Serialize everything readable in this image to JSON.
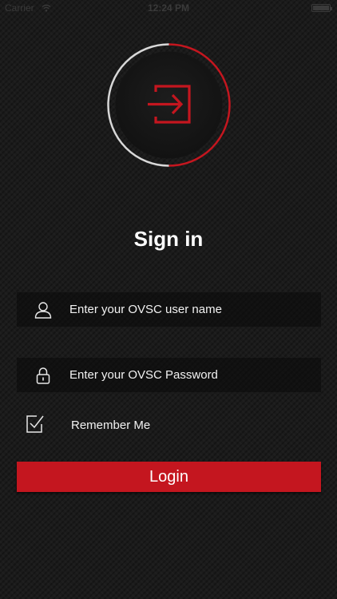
{
  "status_bar": {
    "carrier": "Carrier",
    "time": "12:24 PM"
  },
  "header": {
    "title": "Sign in"
  },
  "form": {
    "username_placeholder": "Enter your OVSC user name",
    "password_placeholder": "Enter your OVSC Password",
    "remember_label": "Remember Me",
    "remember_checked": true,
    "login_label": "Login"
  },
  "icons": {
    "emblem": "sign-in-icon",
    "username": "user-icon",
    "password": "lock-icon",
    "remember": "checkbox-checked-icon",
    "wifi": "wifi-icon",
    "battery": "battery-icon"
  },
  "colors": {
    "accent": "#c4161f",
    "background": "#1b1b1b",
    "ring_light": "#d8d8d8"
  }
}
